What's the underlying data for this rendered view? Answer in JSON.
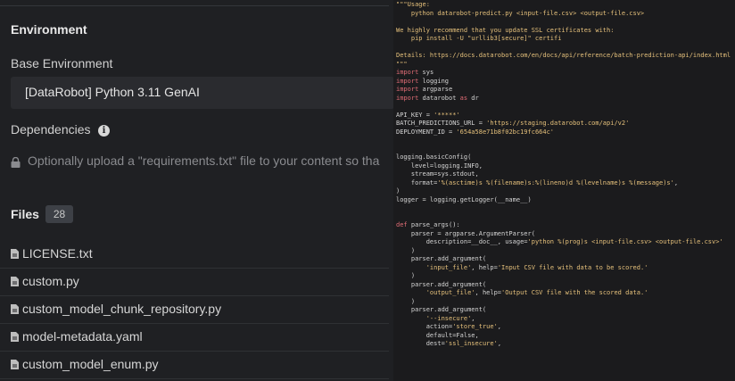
{
  "environment": {
    "heading": "Environment",
    "base_label": "Base Environment",
    "base_value": "[DataRobot] Python 3.11 GenAI",
    "dependencies_label": "Dependencies",
    "upload_note": "Optionally upload a \"requirements.txt\" file to your content so tha"
  },
  "files": {
    "heading": "Files",
    "count": "28",
    "items": [
      {
        "name": "LICENSE.txt"
      },
      {
        "name": "custom.py"
      },
      {
        "name": "custom_model_chunk_repository.py"
      },
      {
        "name": "model-metadata.yaml"
      },
      {
        "name": "custom_model_enum.py"
      }
    ]
  },
  "code_lines": [
    "\"\"\"Usage:",
    "    python datarobot-predict.py <input-file.csv> <output-file.csv>",
    "",
    "We highly recommend that you update SSL certificates with:",
    "    pip install -U \"urllib3[secure]\" certifi",
    "",
    "Details: https://docs.datarobot.com/en/docs/api/reference/batch-prediction-api/index.html",
    "\"\"\"",
    "import sys",
    "import logging",
    "import argparse",
    "import datarobot as dr",
    "",
    "API_KEY = '*****'",
    "BATCH_PREDICTIONS_URL = 'https://staging.datarobot.com/api/v2'",
    "DEPLOYMENT_ID = '654a58e71b8f02bc19fc664c'",
    "",
    "",
    "logging.basicConfig(",
    "    level=logging.INFO,",
    "    stream=sys.stdout,",
    "    format='%(asctime)s %(filename)s:%(lineno)d %(levelname)s %(message)s',",
    ")",
    "logger = logging.getLogger(__name__)",
    "",
    "",
    "def parse_args():",
    "    parser = argparse.ArgumentParser(",
    "        description=__doc__, usage='python %(prog)s <input-file.csv> <output-file.csv>'",
    "    )",
    "    parser.add_argument(",
    "        'input_file', help='Input CSV file with data to be scored.'",
    "    )",
    "    parser.add_argument(",
    "        'output_file', help='Output CSV file with the scored data.'",
    "    )",
    "    parser.add_argument(",
    "        '--insecure',",
    "        action='store_true',",
    "        default=False,",
    "        dest='ssl_insecure',"
  ]
}
